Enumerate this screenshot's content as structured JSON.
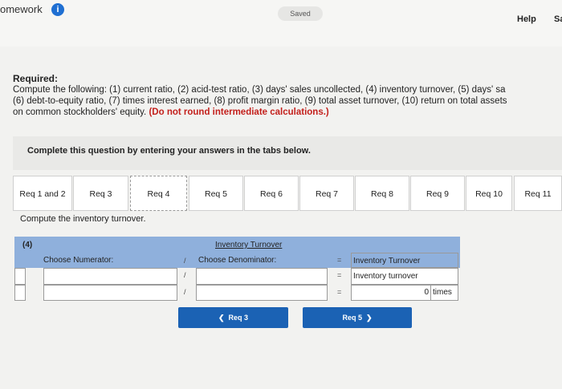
{
  "header": {
    "app_title": "omework",
    "info_icon": "info-icon",
    "saved_label": "Saved",
    "help_label": "Help",
    "save_label": "Sa"
  },
  "question": {
    "required_label": "Required:",
    "instructions_line": "Compute the following: (1) current ratio, (2) acid-test ratio, (3) days' sales uncollected, (4) inventory turnover, (5) days' sa\n(6) debt-to-equity ratio, (7) times interest earned, (8) profit margin ratio, (9) total asset turnover, (10) return on total assets\non common stockholders' equity.",
    "warning": "(Do not round intermediate calculations.)"
  },
  "panel": {
    "title": "Complete this question by entering your answers in the tabs below."
  },
  "tabs": [
    {
      "label": "Req 1 and 2",
      "active": false
    },
    {
      "label": "Req 3",
      "active": false
    },
    {
      "label": "Req 4",
      "active": true
    },
    {
      "label": "Req 5",
      "active": false
    },
    {
      "label": "Req 6",
      "active": false
    },
    {
      "label": "Req 7",
      "active": false
    },
    {
      "label": "Req 8",
      "active": false
    },
    {
      "label": "Req 9",
      "active": false
    },
    {
      "label": "Req 10",
      "active": false
    },
    {
      "label": "Req 11",
      "active": false
    }
  ],
  "req4": {
    "prompt": "Compute the inventory turnover.",
    "table": {
      "number": "(4)",
      "title": "Inventory Turnover",
      "numerator_header": "Choose Numerator:",
      "denominator_header": "Choose Denominator:",
      "divide_symbol": "/",
      "equals_symbol": "=",
      "result_header": "Inventory Turnover",
      "row1": {
        "numerator": "",
        "denominator": "",
        "result": "Inventory turnover"
      },
      "row2": {
        "numerator": "",
        "denominator": "",
        "result_value": "0",
        "result_unit": "times"
      }
    }
  },
  "nav": {
    "prev_label": "Req 3",
    "next_label": "Req 5"
  },
  "colors": {
    "accent_blue": "#1b62b4",
    "table_header": "#8fb0dc",
    "warning_red": "#c3201c"
  }
}
